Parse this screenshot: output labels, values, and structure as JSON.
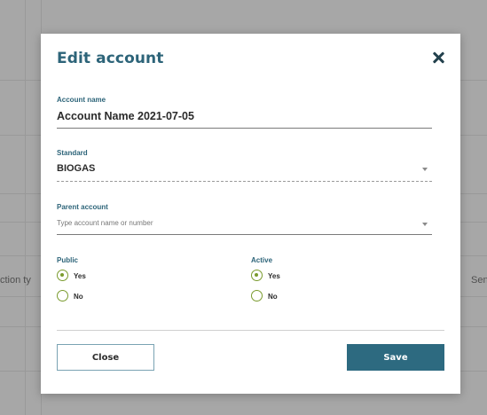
{
  "background": {
    "left_column_text": "ction ty",
    "right_column_text": "Sen"
  },
  "modal": {
    "title": "Edit account",
    "close_icon": "close-icon",
    "account_name": {
      "label": "Account name",
      "value": "Account Name 2021-07-05"
    },
    "standard": {
      "label": "Standard",
      "value": "BIOGAS"
    },
    "parent_account": {
      "label": "Parent account",
      "placeholder": "Type account name or number"
    },
    "public": {
      "label": "Public",
      "options": [
        "Yes",
        "No"
      ],
      "selected": "Yes"
    },
    "active": {
      "label": "Active",
      "options": [
        "Yes",
        "No"
      ],
      "selected": "Yes"
    },
    "buttons": {
      "close": "Close",
      "save": "Save"
    }
  },
  "colors": {
    "accent": "#2d6479",
    "save_button": "#2d6a80",
    "radio": "#7a9b2e"
  }
}
